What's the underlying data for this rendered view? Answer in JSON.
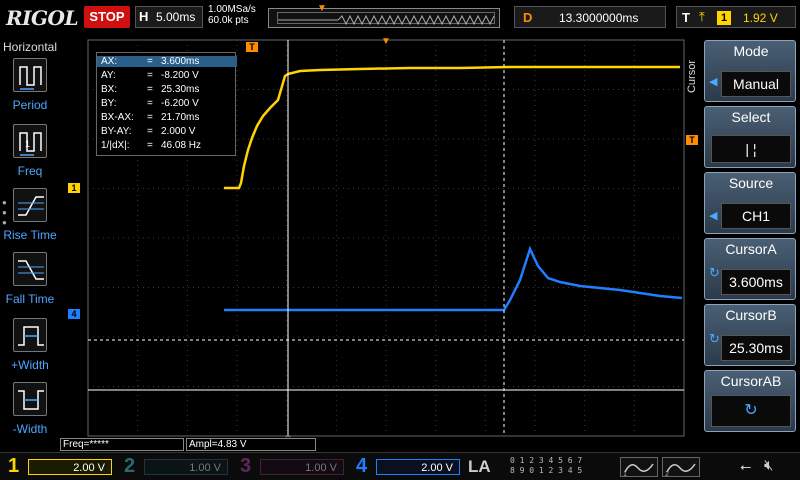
{
  "topbar": {
    "logo": "RIGOL",
    "run_state": "STOP",
    "timebase_letter": "H",
    "timebase": "5.00ms",
    "sample_rate": "1.00MSa/s",
    "mem_depth": "60.0k pts",
    "delay_letter": "D",
    "delay": "13.3000000ms",
    "trigger_letter": "T",
    "trigger_edge_icon": "rising-edge-icon",
    "trigger_source": "1",
    "trigger_level": "1.92 V"
  },
  "left_panel": {
    "title": "Horizontal",
    "items": [
      {
        "label": "Period",
        "icon": "period-icon"
      },
      {
        "label": "Freq",
        "icon": "freq-icon"
      },
      {
        "label": "Rise Time",
        "icon": "rise-time-icon"
      },
      {
        "label": "Fall Time",
        "icon": "fall-time-icon"
      },
      {
        "label": "+Width",
        "icon": "pos-width-icon"
      },
      {
        "label": "-Width",
        "icon": "neg-width-icon"
      }
    ]
  },
  "cursor_readout": {
    "rows": [
      {
        "k": "AX:",
        "eq": "=",
        "v": "3.600ms"
      },
      {
        "k": "AY:",
        "eq": "=",
        "v": "-8.200 V"
      },
      {
        "k": "BX:",
        "eq": "=",
        "v": "25.30ms"
      },
      {
        "k": "BY:",
        "eq": "=",
        "v": "-6.200 V"
      },
      {
        "k": "BX-AX:",
        "eq": "=",
        "v": "21.70ms"
      },
      {
        "k": "BY-AY:",
        "eq": "=",
        "v": "2.000 V"
      },
      {
        "k": "1/|dX|:",
        "eq": "=",
        "v": "46.08 Hz"
      }
    ]
  },
  "markers": {
    "trigger_pos": "T",
    "ch1": "1",
    "ch4": "4",
    "trigger_level": "T"
  },
  "measurements": {
    "freq": "Freq=*****",
    "ampl": "Ampl=4.83 V"
  },
  "right_menu": {
    "side_label": "Cursor",
    "mode_title": "Mode",
    "mode_value": "Manual",
    "select_title": "Select",
    "select_value": "|    ¦",
    "source_title": "Source",
    "source_value": "CH1",
    "cursorA_title": "CursorA",
    "cursorA_value": "3.600ms",
    "cursorB_title": "CursorB",
    "cursorB_value": "25.30ms",
    "cursorAB_title": "CursorAB"
  },
  "bottom": {
    "channels": [
      {
        "num": "1",
        "scale": "2.00 V",
        "color": "#ffd400",
        "active": true
      },
      {
        "num": "2",
        "scale": "1.00 V",
        "color": "#00c8c8",
        "active": false
      },
      {
        "num": "3",
        "scale": "1.00 V",
        "color": "#d040d0",
        "active": false
      },
      {
        "num": "4",
        "scale": "2.00 V",
        "color": "#1e7fff",
        "active": true
      }
    ],
    "la": "LA",
    "la_digits_top": "0 1 2 3  4 5 6 7",
    "la_digits_bottom": "8 9 0 1  2 3 4 5"
  },
  "colors": {
    "ch1": "#ffd400",
    "ch4": "#1e7fff",
    "trigger": "#ff8c00",
    "grid": "#555555"
  }
}
